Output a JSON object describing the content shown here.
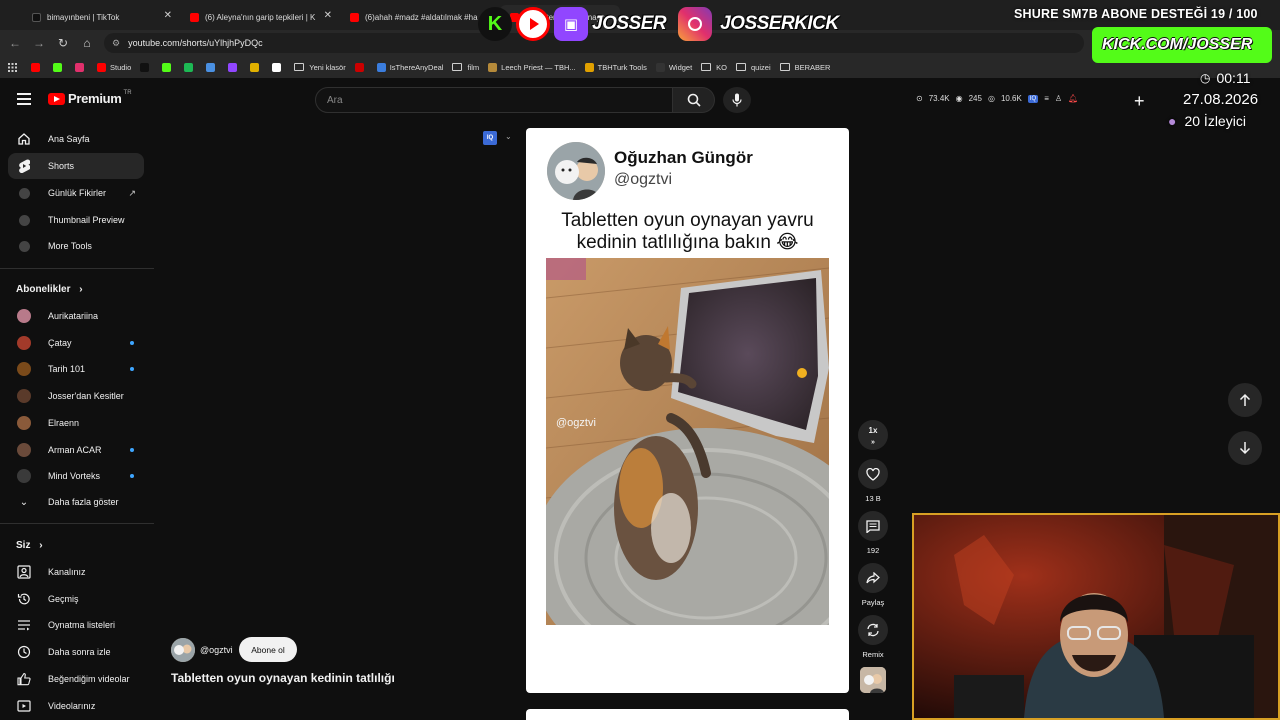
{
  "browser": {
    "tabs": [
      {
        "label": "bimayınbeni | TikTok",
        "color": "#111111"
      },
      {
        "label": "(6) Aleyna'nın garip tepkileri | K",
        "color": "#ff0000"
      },
      {
        "label": "(6)ahah #madz #aldatılmak #ha",
        "color": "#ff0000"
      },
      {
        "label": "Tabletten oyun oynayan",
        "color": "#ff0000"
      }
    ],
    "url": "youtube.com/shorts/uYlhjhPyDQc",
    "bookmarks": [
      {
        "label": "",
        "color": "#ff0000"
      },
      {
        "label": "",
        "color": "#53fc18"
      },
      {
        "label": "",
        "color": "#e1306c"
      },
      {
        "label": "Studio",
        "color": "#ff0000"
      },
      {
        "label": "",
        "color": "#111111"
      },
      {
        "label": "",
        "color": "#53fc18"
      },
      {
        "label": "",
        "color": "#1db954"
      },
      {
        "label": "",
        "color": "#4a90e2"
      },
      {
        "label": "",
        "color": "#9146ff"
      },
      {
        "label": "",
        "color": "#e0b000"
      },
      {
        "label": "",
        "color": "#ffffff"
      },
      {
        "label": "Yeni klasör",
        "folder": true
      },
      {
        "label": "",
        "color": "#cc0000"
      },
      {
        "label": "IsThereAnyDeal",
        "color": "#3b7ddd"
      },
      {
        "label": "film",
        "folder": true
      },
      {
        "label": "Leech Priest — TBH...",
        "color": "#b58a3a"
      },
      {
        "label": "TBHTurk Tools",
        "color": "#e0a000"
      },
      {
        "label": "Widget",
        "color": "#333333"
      },
      {
        "label": "KO",
        "folder": true
      },
      {
        "label": "quizei",
        "folder": true
      },
      {
        "label": "BERABER",
        "folder": true
      }
    ]
  },
  "youtube": {
    "logo_word": "Premium",
    "logo_region": "TR",
    "search_placeholder": "Ara",
    "ext_stats": {
      "views": "73.4K",
      "eye": "245",
      "watch": "10.6K"
    },
    "sidebar": {
      "top": [
        {
          "label": "Ana Sayfa",
          "icon": "home-icon"
        },
        {
          "label": "Shorts",
          "icon": "shorts-icon",
          "active": true
        },
        {
          "label": "Günlük Fikirler",
          "icon": "iq-icon"
        },
        {
          "label": "Thumbnail Preview",
          "icon": "iq-icon"
        },
        {
          "label": "More Tools",
          "icon": "iq-icon"
        }
      ],
      "subscriptions_title": "Abonelikler",
      "subscriptions": [
        {
          "label": "Aurikatariina",
          "color": "#b87a8a",
          "dot": false
        },
        {
          "label": "Çatay",
          "color": "#a23a2a",
          "dot": true
        },
        {
          "label": "Tarih 101",
          "color": "#7a4a1a",
          "dot": true
        },
        {
          "label": "Josser'dan Kesitler",
          "color": "#5a3a2a",
          "dot": false
        },
        {
          "label": "Elraenn",
          "color": "#8a5a3a",
          "dot": false
        },
        {
          "label": "Arman ACAR",
          "color": "#6a4a3a",
          "dot": true
        },
        {
          "label": "Mind Vorteks",
          "color": "#3a3a3a",
          "dot": true
        }
      ],
      "show_more": "Daha fazla göster",
      "you_title": "Siz",
      "you": [
        {
          "label": "Kanalınız",
          "icon": "channel-icon"
        },
        {
          "label": "Geçmiş",
          "icon": "history-icon"
        },
        {
          "label": "Oynatma listeleri",
          "icon": "playlists-icon"
        },
        {
          "label": "Daha sonra izle",
          "icon": "watch-later-icon"
        },
        {
          "label": "Beğendiğim videolar",
          "icon": "like-icon"
        },
        {
          "label": "Videolarınız",
          "icon": "videos-icon"
        }
      ]
    },
    "short": {
      "author_name": "Oğuzhan Güngör",
      "author_handle": "@ogztvi",
      "text_line1": "Tabletten oyun oynayan yavru",
      "text_line2": "kedinin tatlılığına bakın 😂",
      "watermark": "@ogztvi",
      "speed": "1x",
      "likes": "13 B",
      "comments": "192",
      "share_label": "Paylaş",
      "remix_label": "Remix",
      "channel": "@ogztvi",
      "subscribe_label": "Abone ol",
      "title": "Tabletten oyun oynayan kedinin tatlılığı"
    }
  },
  "overlay": {
    "banner": "SHURE SM7B ABONE DESTEĞİ 19 / 100",
    "brand1": "JOSSER",
    "brand2": "JOSSERKICK",
    "kick_url": "KICK.COM/JOSSER",
    "clock": "00:11",
    "date": "27.08.2026",
    "viewers": "20 İzleyici"
  }
}
